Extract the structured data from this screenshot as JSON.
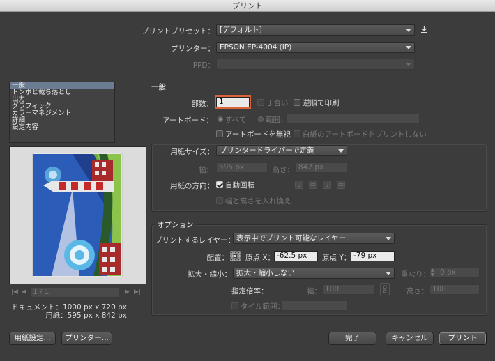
{
  "window": {
    "title": "プリント"
  },
  "header": {
    "preset_label": "プリントプリセット：",
    "preset_value": "[デフォルト]",
    "printer_label": "プリンター：",
    "printer_value": "EPSON EP-4004 (IP)",
    "ppd_label": "PPD："
  },
  "sidebar": {
    "items": [
      "一般",
      "トンボと裁ち落とし",
      "出力",
      "グラフィック",
      "カラーマネジメント",
      "詳細",
      "設定内容"
    ],
    "selected_index": 0
  },
  "preview": {
    "page_field": "1 / 1",
    "doc_info": "ドキュメント：1000 px x 720 px",
    "paper_info": "用紙：595 px x 842 px"
  },
  "general": {
    "section_title": "一般",
    "copies_label": "部数：",
    "copies_value": "1",
    "collate_label": "丁合い",
    "reverse_label": "逆順で印刷",
    "artboard_label": "アートボード：",
    "all_label": "すべて",
    "range_label": "範囲：",
    "ignore_artboards_label": "アートボードを無視",
    "skip_blank_label": "白紙のアートボードをプリントしない",
    "collate_checked": false,
    "reverse_checked": false,
    "ignore_artboards_checked": false,
    "skip_blank_checked": false
  },
  "media": {
    "size_label": "用紙サイズ：",
    "size_value": "プリンタードライバーで定義",
    "width_label": "幅：",
    "width_value": "595 px",
    "height_label": "高さ：",
    "height_value": "842 px",
    "orientation_label": "用紙の方向：",
    "auto_rotate_label": "自動回転",
    "auto_rotate_checked": true,
    "transverse_label": "幅と高さを入れ換え",
    "transverse_checked": false
  },
  "options": {
    "section_title": "オプション",
    "layers_label": "プリントするレイヤー：",
    "layers_value": "表示中でプリント可能なレイヤー",
    "placement_label": "配置：",
    "origin_x_label": "原点 X：",
    "origin_x_value": "-62.5 px",
    "origin_y_label": "原点 Y：",
    "origin_y_value": "-79 px",
    "scale_label": "拡大・縮小：",
    "scale_value": "拡大・縮小しない",
    "overlap_label": "重なり：",
    "overlap_value": "0 px",
    "custom_scale_label": "指定倍率：",
    "scale_width_label": "幅：",
    "scale_width_value": "100",
    "scale_height_label": "高さ：",
    "scale_height_value": "100",
    "tile_range_label": "タイル範囲：",
    "tile_checked": false
  },
  "footer": {
    "page_setup_label": "用紙設定...",
    "printer_button_label": "プリンター...",
    "done_label": "完了",
    "cancel_label": "キャンセル",
    "print_label": "プリント"
  }
}
